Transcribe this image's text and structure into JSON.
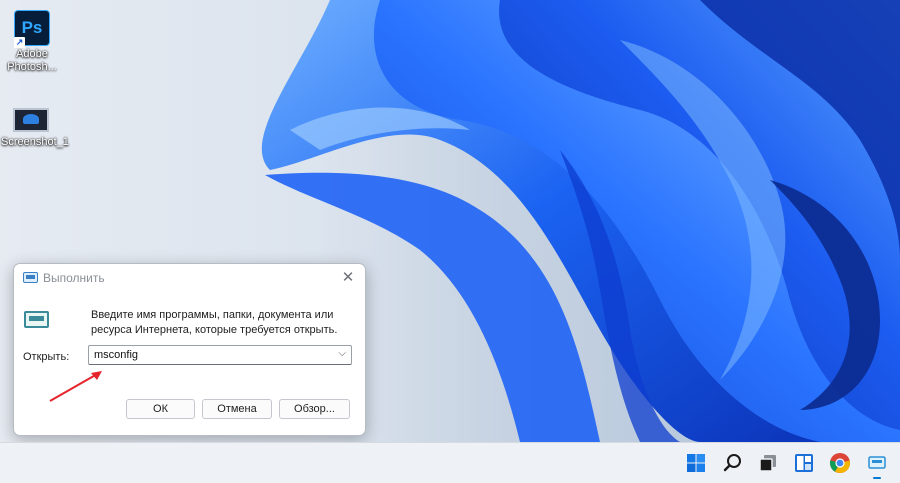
{
  "desktop": {
    "icons": [
      {
        "label": "Adobe Photosh...",
        "icon": "photoshop-icon",
        "glyph": "Ps"
      },
      {
        "label": "Screenshot_1",
        "icon": "image-file-icon"
      }
    ]
  },
  "run_dialog": {
    "title": "Выполнить",
    "close_glyph": "✕",
    "description": "Введите имя программы, папки, документа или ресурса Интернета, которые требуется открыть.",
    "open_label": "Открыть:",
    "open_value": "msconfig",
    "dropdown_glyph": "⌵",
    "buttons": {
      "ok": "ОК",
      "cancel": "Отмена",
      "browse": "Обзор..."
    }
  },
  "taskbar": {
    "items": [
      "start-icon",
      "search-icon",
      "task-view-icon",
      "widgets-icon",
      "chrome-icon",
      "run-app-icon"
    ]
  },
  "colors": {
    "wallpaper_blue": "#1457f0",
    "annotation_arrow": "#e5242b",
    "accent": "#0078d4"
  }
}
